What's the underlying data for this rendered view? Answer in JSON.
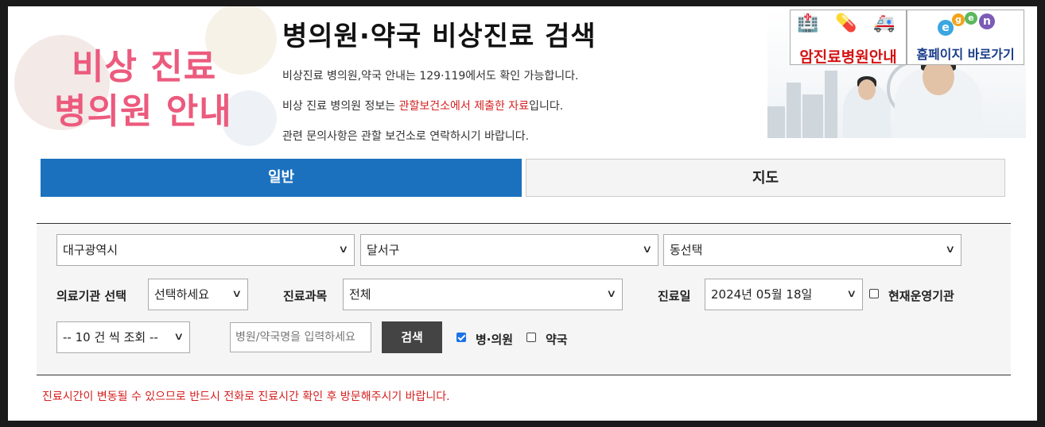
{
  "banner": {
    "line1": "비상 진료",
    "line2": "병의원 안내"
  },
  "header": {
    "title": "병의원·약국 비상진료 검색",
    "info1": "비상진료 병의원,약국 안내는 129·119에서도 확인 가능합니다.",
    "info2_pre": "비상 진료 병의원 정보는 ",
    "info2_red": "관할보건소에서 제출한 자료",
    "info2_post": "입니다.",
    "info3": "관련 문의사항은 관할 보건소로 연락하시기 바랍니다."
  },
  "links": {
    "cancer": {
      "label": "암진료병원안내",
      "icons": [
        "hospital-icon",
        "medicine-icon",
        "ambulance-icon"
      ]
    },
    "homepage": {
      "label": "홈페이지 바로가기"
    }
  },
  "tabs": [
    {
      "label": "일반"
    },
    {
      "label": "지도"
    }
  ],
  "tabs_colors": {
    "active": "#1b71be"
  },
  "search": {
    "city": "대구광역시",
    "district": "달서구",
    "dong": "동선택",
    "institution_label": "의료기관 선택",
    "institution_value": "선택하세요",
    "department_label": "진료과목",
    "department_value": "전체",
    "date_label": "진료일",
    "date_value": "2024년 05월 18일",
    "operating_label": "현재운영기관",
    "operating_checked": false,
    "page_size": "-- 10 건 씩 조회 --",
    "name_placeholder": "병원/약국명을 입력하세요",
    "search_button": "검색",
    "clinic_label": "병·의원",
    "clinic_checked": true,
    "pharmacy_label": "약국",
    "pharmacy_checked": false
  },
  "notice": "진료시간이 변동될 수 있으므로 반드시 전화로 진료시간 확인 후 방문해주시기 바랍니다."
}
